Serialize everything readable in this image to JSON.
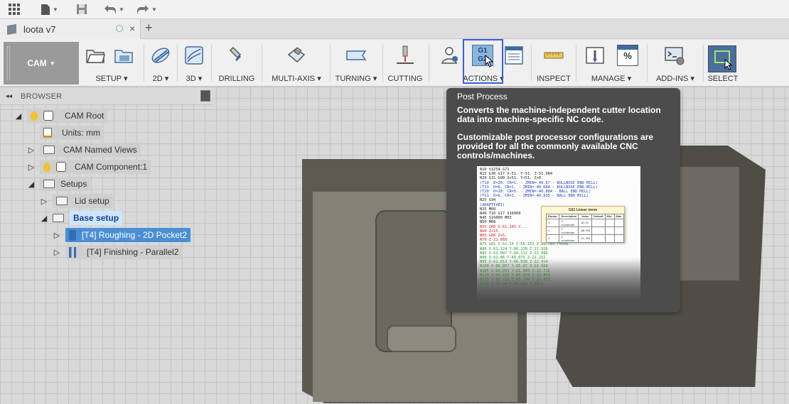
{
  "quick_access": {
    "grid_icon": "app-grid-icon",
    "file_icon": "file-icon",
    "save_icon": "save-icon",
    "undo_icon": "undo-icon",
    "redo_icon": "redo-icon"
  },
  "document_tab": {
    "title": "loota v7",
    "close_glyph": "×",
    "new_tab_glyph": "+"
  },
  "toolbar": {
    "workspace": "CAM",
    "groups": {
      "setup": "SETUP",
      "twoD": "2D",
      "threeD": "3D",
      "drilling": "DRILLING",
      "multiaxis": "MULTI-AXIS",
      "turning": "TURNING",
      "cutting": "CUTTING",
      "actions": "ACTIONS",
      "inspect": "INSPECT",
      "manage": "MANAGE",
      "addins": "ADD-INS",
      "select": "SELECT"
    },
    "dropdown_glyph": "▾",
    "g1g2": {
      "line1": "G1",
      "line2": "G2"
    },
    "percent": "%",
    "accent_color": "#3a5fe0"
  },
  "browser": {
    "title": "BROWSER",
    "collapse_glyph": "◂◂",
    "items": [
      {
        "label": "CAM Root"
      },
      {
        "label": "Units: mm"
      },
      {
        "label": "CAM Named Views"
      },
      {
        "label": "CAM Component:1"
      },
      {
        "label": "Setups"
      },
      {
        "label": "Lid setup"
      },
      {
        "label": "Base setup"
      },
      {
        "label": "[T4] Roughing - 2D Pocket2"
      },
      {
        "label": "[T4] Finishing - Parallel2"
      }
    ]
  },
  "tooltip": {
    "title": "Post Process",
    "p1": "Converts the machine-independent cutter location data into machine-specific NC code.",
    "p2": "Customizable post processor configurations are provided for all the commonly available CNC controls/machines.",
    "code_lines": [
      {
        "text": "N10 %1234 G71",
        "cls": "c-blk"
      },
      {
        "text": "N15 G30 G17 X-51. Y-51. Z-51.984",
        "cls": "c-blk"
      },
      {
        "text": "N20 G31 G90 X+51. Y+51. Z+0.",
        "cls": "c-blk"
      },
      {
        "text": "(T10  D=20. CR=1. - ZMIN=-40.67 - BULLNOSE END MILL)",
        "cls": "c-blue"
      },
      {
        "text": "(T13  D=6. CR=1. - ZMIN=-40.684 - BULLNOSE END MILL)",
        "cls": "c-blue"
      },
      {
        "text": "(T20  D=10. CR=5. - ZMIN=-40.884 - BALL END MILL)",
        "cls": "c-blue"
      },
      {
        "text": "(T21  D=6. CR=3. - ZMIN=-40.935 - BALL END MILL)",
        "cls": "c-blue"
      },
      {
        "text": "N25 G94",
        "cls": "c-blk"
      },
      {
        "text": "(ADAPTIVE1)",
        "cls": "c-blue"
      },
      {
        "text": "N35 M09",
        "cls": "c-blk"
      },
      {
        "text": "N40 T10 G17 S16000",
        "cls": "c-blk"
      },
      {
        "text": "N45 S16000 M03",
        "cls": "c-blk"
      },
      {
        "text": "N50 M08",
        "cls": "c-blk"
      },
      {
        "text": "N55 G00 X-61.145 Y...",
        "cls": "c-red"
      },
      {
        "text": "N60 Z+15.",
        "cls": "c-red"
      },
      {
        "text": "N65 G00 Z+5.",
        "cls": "c-red"
      },
      {
        "text": "N70 Z-21.668",
        "cls": "c-red"
      },
      {
        "text": "N75 G01 X-61.14 Y-66.155 Z-21.783 F9500.",
        "cls": "c-green"
      },
      {
        "text": "N80 X-61.124 Y-66.139 Z-21.916",
        "cls": "c-green"
      },
      {
        "text": "N85 X-61.097 Y-66.112 Z-22.086",
        "cls": "c-green"
      },
      {
        "text": "N90 X-61.06 Y-66.075 Z-22.252",
        "cls": "c-green"
      },
      {
        "text": "N95 X-61.013 Y-66.028 Z-22.414",
        "cls": "c-green"
      },
      {
        "text": "N100 X-60.957 Y-65.97 Z-22.568",
        "cls": "c-green"
      },
      {
        "text": "N105 X-60.893 Y-65.904 Z-22.715",
        "cls": "c-green"
      },
      {
        "text": "N110 X-60.816 Y-65.829 Z-22.854",
        "cls": "c-green"
      },
      {
        "text": "N115 X-60.732 Y-65.745 Z-22.983",
        "cls": "c-green"
      },
      {
        "text": "N120 X-60.64 Y-65.649 Z-23.1",
        "cls": "c-green"
      }
    ],
    "popup": {
      "title": "G01 Linear move",
      "headers": [
        "Param.",
        "Description",
        "Value",
        "Default",
        "Min.",
        "Max."
      ],
      "rows": [
        [
          "X",
          "X coordinate",
          "-61.14",
          "",
          "",
          ""
        ],
        [
          "Y",
          "Y coordinate",
          "-66.155",
          "",
          "",
          ""
        ],
        [
          "Z",
          "Z coordinate",
          "-21.783",
          "",
          "",
          ""
        ]
      ]
    }
  }
}
